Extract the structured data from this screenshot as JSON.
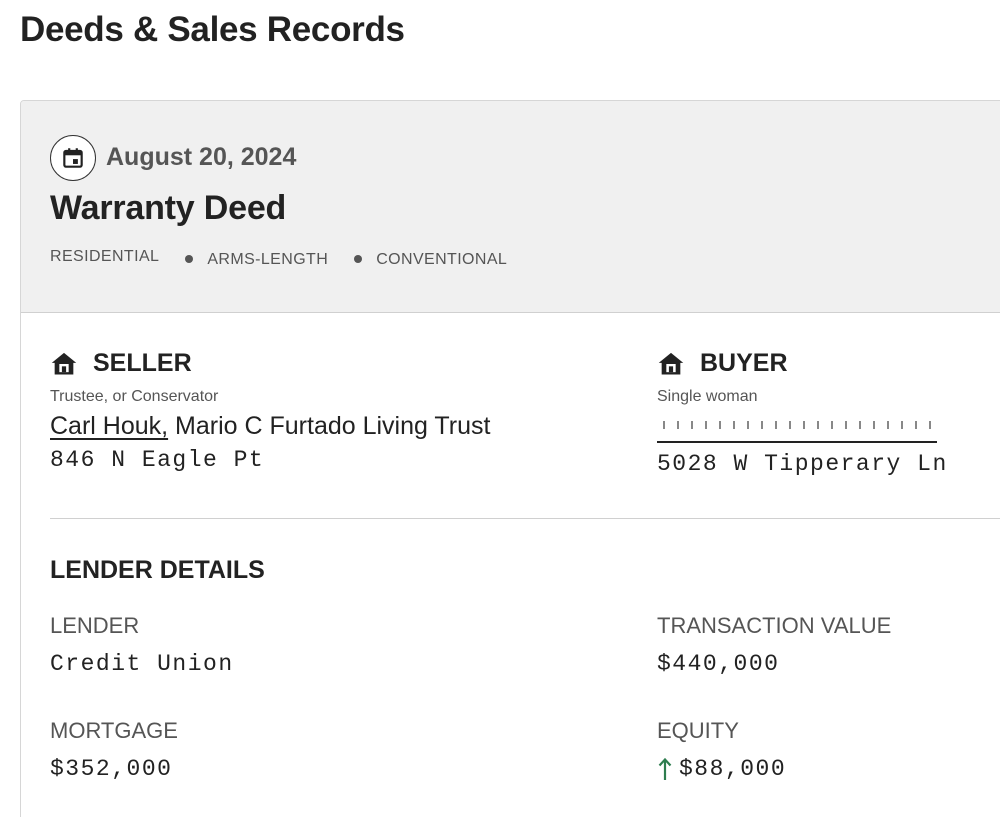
{
  "page": {
    "title": "Deeds & Sales Records"
  },
  "record": {
    "date": "August 20, 2024",
    "deed_type": "Warranty Deed",
    "tags": [
      "RESIDENTIAL",
      "ARMS-LENGTH",
      "CONVENTIONAL"
    ],
    "seller": {
      "label": "SELLER",
      "subtitle": "Trustee, or Conservator",
      "name_link": "Carl Houk,",
      "name_rest": " Mario C Furtado Living Trust",
      "address": "846 N Eagle Pt",
      "icon": "house-icon"
    },
    "buyer": {
      "label": "BUYER",
      "subtitle": "Single woman",
      "name_redacted": true,
      "address": "5028 W Tipperary Ln",
      "icon": "house-icon"
    },
    "lender_details": {
      "title": "LENDER DETAILS",
      "lender_label": "LENDER",
      "lender_value": "Credit Union",
      "transaction_label": "TRANSACTION VALUE",
      "transaction_value": "$440,000",
      "mortgage_label": "MORTGAGE",
      "mortgage_value": "$352,000",
      "equity_label": "EQUITY",
      "equity_value": "$88,000",
      "equity_trend_icon": "arrow-up-icon",
      "equity_trend_color": "#2e7d4f"
    }
  },
  "colors": {
    "header_bg": "#f0f0f0",
    "text_primary": "#222222",
    "text_secondary": "#555555",
    "border": "#d0d0d0"
  }
}
